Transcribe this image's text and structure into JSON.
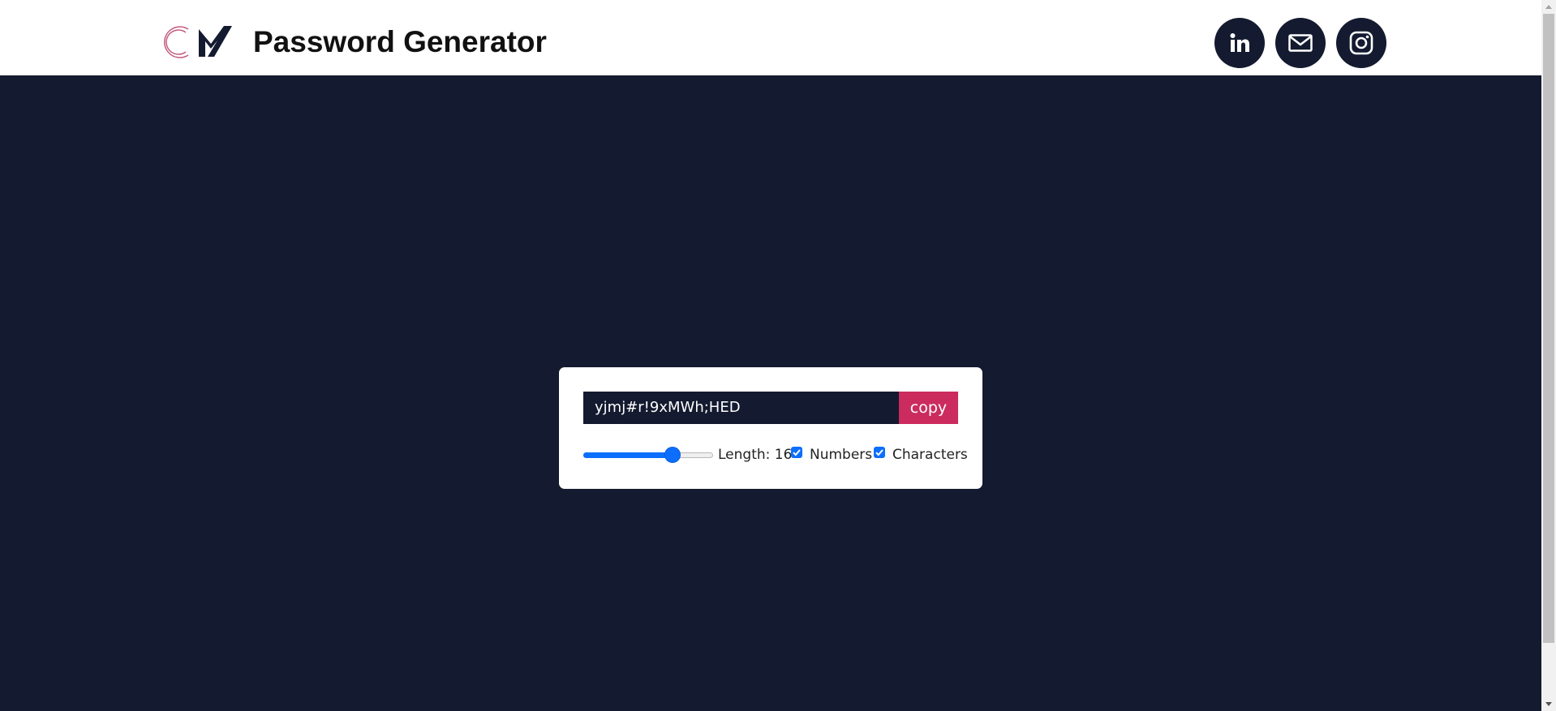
{
  "header": {
    "logo_text": "CM",
    "title": "Password Generator",
    "social": [
      {
        "name": "linkedin",
        "icon": "linkedin-icon"
      },
      {
        "name": "mail",
        "icon": "mail-icon"
      },
      {
        "name": "instagram",
        "icon": "instagram-icon"
      }
    ]
  },
  "generator": {
    "password": "yjmj#r!9xMWh;HED",
    "copy_label": "copy",
    "length_label": "Length: 16",
    "length_value": 16,
    "slider_fraction": 0.69,
    "options": [
      {
        "label": "Numbers",
        "checked": true
      },
      {
        "label": "Characters",
        "checked": true
      }
    ]
  },
  "colors": {
    "background": "#141a2f",
    "header_background": "#ffffff",
    "accent": "#cb2c5d",
    "slider_blue": "#0d6efd",
    "logo_pink": "#c45b7e"
  }
}
